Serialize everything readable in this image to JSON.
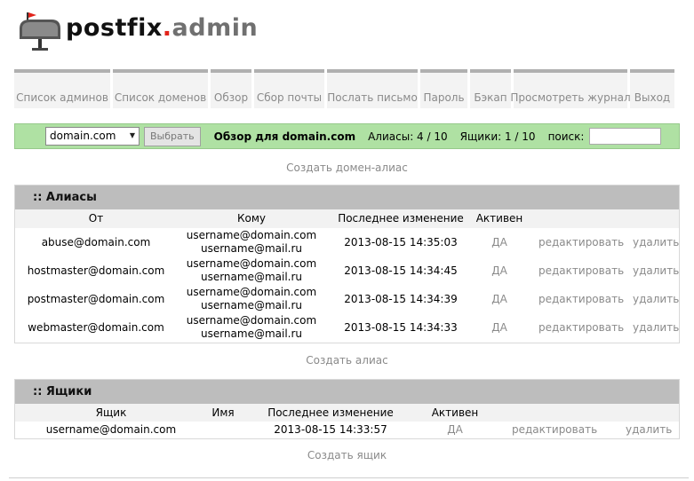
{
  "logo": {
    "part1": "postfix",
    "dot": ".",
    "part2": "admin",
    "icon": "mailbox-icon"
  },
  "menu": [
    "Список админов",
    "Список доменов",
    "Обзор",
    "Сбор почты",
    "Послать письмо",
    "Пароль",
    "Бэкап",
    "Просмотреть журнал",
    "Выход"
  ],
  "overview": {
    "domain_value": "domain.com",
    "select_button": "Выбрать",
    "title": "Обзор для domain.com",
    "aliases_count": "Алиасы: 4 / 10",
    "mailboxes_count": "Ящики: 1 / 10",
    "search_label": "поиск:",
    "search_value": ""
  },
  "create_domain_alias": "Создать домен-алиас",
  "aliases": {
    "heading": ":: Алиасы",
    "columns": {
      "from": "От",
      "to": "Кому",
      "modified": "Последнее изменение",
      "active": "Активен"
    },
    "rows": [
      {
        "from": "abuse@domain.com",
        "to1": "username@domain.com",
        "to2": "username@mail.ru",
        "modified": "2013-08-15 14:35:03",
        "active": "ДА",
        "edit": "редактировать",
        "delete": "удалить"
      },
      {
        "from": "hostmaster@domain.com",
        "to1": "username@domain.com",
        "to2": "username@mail.ru",
        "modified": "2013-08-15 14:34:45",
        "active": "ДА",
        "edit": "редактировать",
        "delete": "удалить"
      },
      {
        "from": "postmaster@domain.com",
        "to1": "username@domain.com",
        "to2": "username@mail.ru",
        "modified": "2013-08-15 14:34:39",
        "active": "ДА",
        "edit": "редактировать",
        "delete": "удалить"
      },
      {
        "from": "webmaster@domain.com",
        "to1": "username@domain.com",
        "to2": "username@mail.ru",
        "modified": "2013-08-15 14:34:33",
        "active": "ДА",
        "edit": "редактировать",
        "delete": "удалить"
      }
    ],
    "create_link": "Создать алиас"
  },
  "mailboxes": {
    "heading": ":: Ящики",
    "columns": {
      "mailbox": "Ящик",
      "name": "Имя",
      "modified": "Последнее изменение",
      "active": "Активен"
    },
    "rows": [
      {
        "mailbox": "username@domain.com",
        "name": "",
        "modified": "2013-08-15 14:33:57",
        "active": "ДА",
        "edit": "редактировать",
        "delete": "удалить"
      }
    ],
    "create_link": "Создать ящик"
  },
  "colors": {
    "overview_bg": "#afe1a3",
    "panel_head": "#bdbdbd",
    "logo_dot": "#e2231a"
  }
}
